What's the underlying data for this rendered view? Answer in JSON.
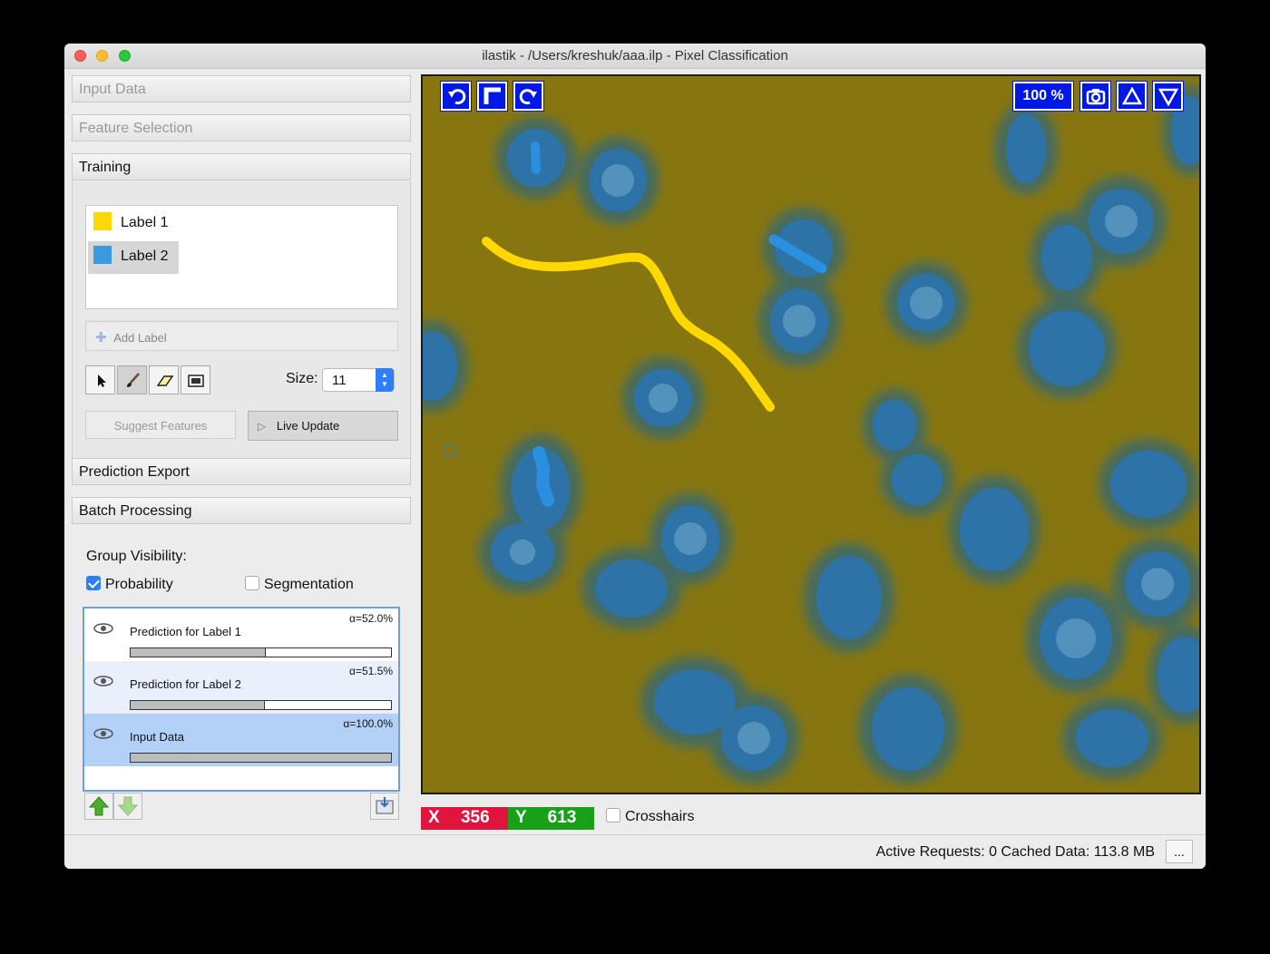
{
  "window": {
    "title": "ilastik - /Users/kreshuk/aaa.ilp - Pixel Classification"
  },
  "applets": {
    "input_data": "Input Data",
    "feature_selection": "Feature Selection",
    "training": "Training",
    "prediction_export": "Prediction Export",
    "batch_processing": "Batch Processing"
  },
  "labels": [
    {
      "name": "Label 1",
      "color": "#ffd800"
    },
    {
      "name": "Label 2",
      "color": "#3a9ae0"
    }
  ],
  "add_label": "Add Label",
  "size": {
    "label": "Size:",
    "value": "11"
  },
  "buttons": {
    "suggest_features": "Suggest Features",
    "live_update": "Live Update"
  },
  "group_visibility": {
    "title": "Group Visibility:",
    "probability": {
      "label": "Probability",
      "checked": true
    },
    "segmentation": {
      "label": "Segmentation",
      "checked": false
    }
  },
  "layers": [
    {
      "name": "Prediction for Label 1",
      "alpha": "α=52.0%",
      "opacity": 0.52
    },
    {
      "name": "Prediction for Label 2",
      "alpha": "α=51.5%",
      "opacity": 0.515
    },
    {
      "name": "Input Data",
      "alpha": "α=100.0%",
      "opacity": 1.0
    }
  ],
  "viewer": {
    "zoom": "100 %",
    "icons": [
      "undo-icon",
      "reset-view-icon",
      "redo-icon",
      "camera-icon",
      "slice-up-icon",
      "slice-down-icon"
    ]
  },
  "coords": {
    "x_label": "X",
    "x_value": "356",
    "y_label": "Y",
    "y_value": "613",
    "x_color": "#e0143c",
    "y_color": "#18a018"
  },
  "crosshairs": "Crosshairs",
  "status": {
    "text": "Active Requests: 0  Cached Data: 113.8 MB",
    "more": "..."
  }
}
